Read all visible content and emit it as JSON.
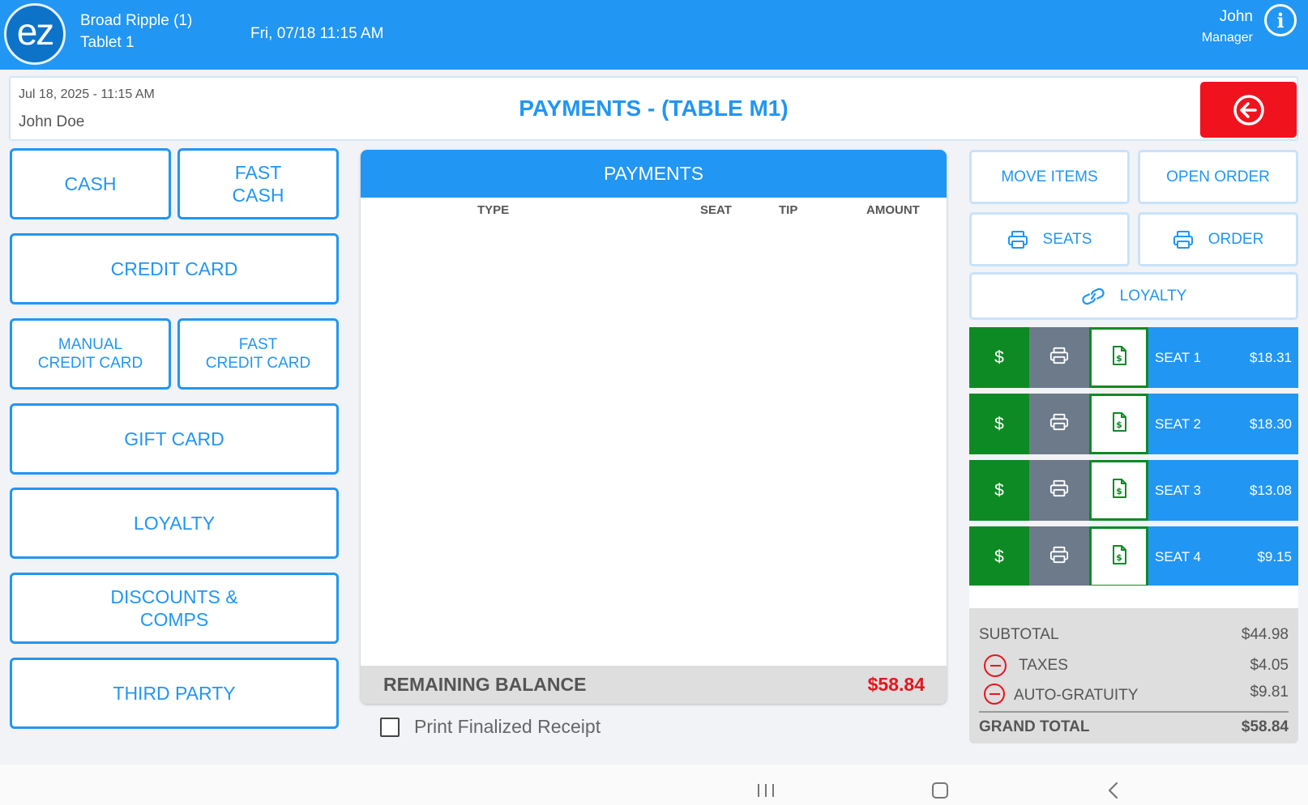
{
  "topbar": {
    "logo_text": "ez",
    "location": "Broad Ripple (1)",
    "device": "Tablet 1",
    "datetime": "Fri, 07/18 11:15 AM",
    "user_name": "John",
    "user_role": "Manager",
    "info_icon": "i"
  },
  "header": {
    "date": "Jul 18, 2025  - 11:15 AM",
    "customer": "John Doe",
    "title": "PAYMENTS - (TABLE M1)"
  },
  "payment_methods": {
    "cash": "CASH",
    "fast_cash_1": "FAST",
    "fast_cash_2": "CASH",
    "credit_card": "CREDIT CARD",
    "manual_cc_1": "MANUAL",
    "manual_cc_2": "CREDIT CARD",
    "fast_cc_1": "FAST",
    "fast_cc_2": "CREDIT CARD",
    "gift_card": "GIFT CARD",
    "loyalty": "LOYALTY",
    "discounts_1": "DISCOUNTS &",
    "discounts_2": "COMPS",
    "third_party": "THIRD PARTY"
  },
  "payments_panel": {
    "title": "PAYMENTS",
    "columns": {
      "type": "TYPE",
      "seat": "SEAT",
      "tip": "TIP",
      "amount": "AMOUNT"
    },
    "rows": [],
    "remaining_label": "REMAINING BALANCE",
    "remaining_value": "$58.84"
  },
  "print_receipt": {
    "label": "Print Finalized Receipt",
    "checked": false
  },
  "actions": {
    "move_items": "MOVE ITEMS",
    "open_order": "OPEN ORDER",
    "print_seats": "SEATS",
    "print_order": "ORDER",
    "loyalty": "LOYALTY"
  },
  "seats": [
    {
      "pay_symbol": "$",
      "name": "SEAT 1",
      "amount": "$18.31"
    },
    {
      "pay_symbol": "$",
      "name": "SEAT 2",
      "amount": "$18.30"
    },
    {
      "pay_symbol": "$",
      "name": "SEAT 3",
      "amount": "$13.08"
    },
    {
      "pay_symbol": "$",
      "name": "SEAT 4",
      "amount": "$9.15"
    }
  ],
  "totals": {
    "subtotal_label": "SUBTOTAL",
    "subtotal": "$44.98",
    "taxes_label": "TAXES",
    "taxes": "$4.05",
    "gratuity_label": "AUTO-GRATUITY",
    "gratuity": "$9.81",
    "grand_total_label": "GRAND TOTAL",
    "grand_total": "$58.84"
  },
  "colors": {
    "brand_blue": "#2196f3",
    "alert_red": "#f0131d",
    "pay_green": "#0e8a24",
    "print_gray": "#6c7a8a"
  },
  "icons": {
    "back": "arrow-left-circle-icon",
    "printer": "printer-icon",
    "link": "link-icon",
    "receipt": "dollar-document-icon",
    "remove": "minus-circle-icon"
  }
}
